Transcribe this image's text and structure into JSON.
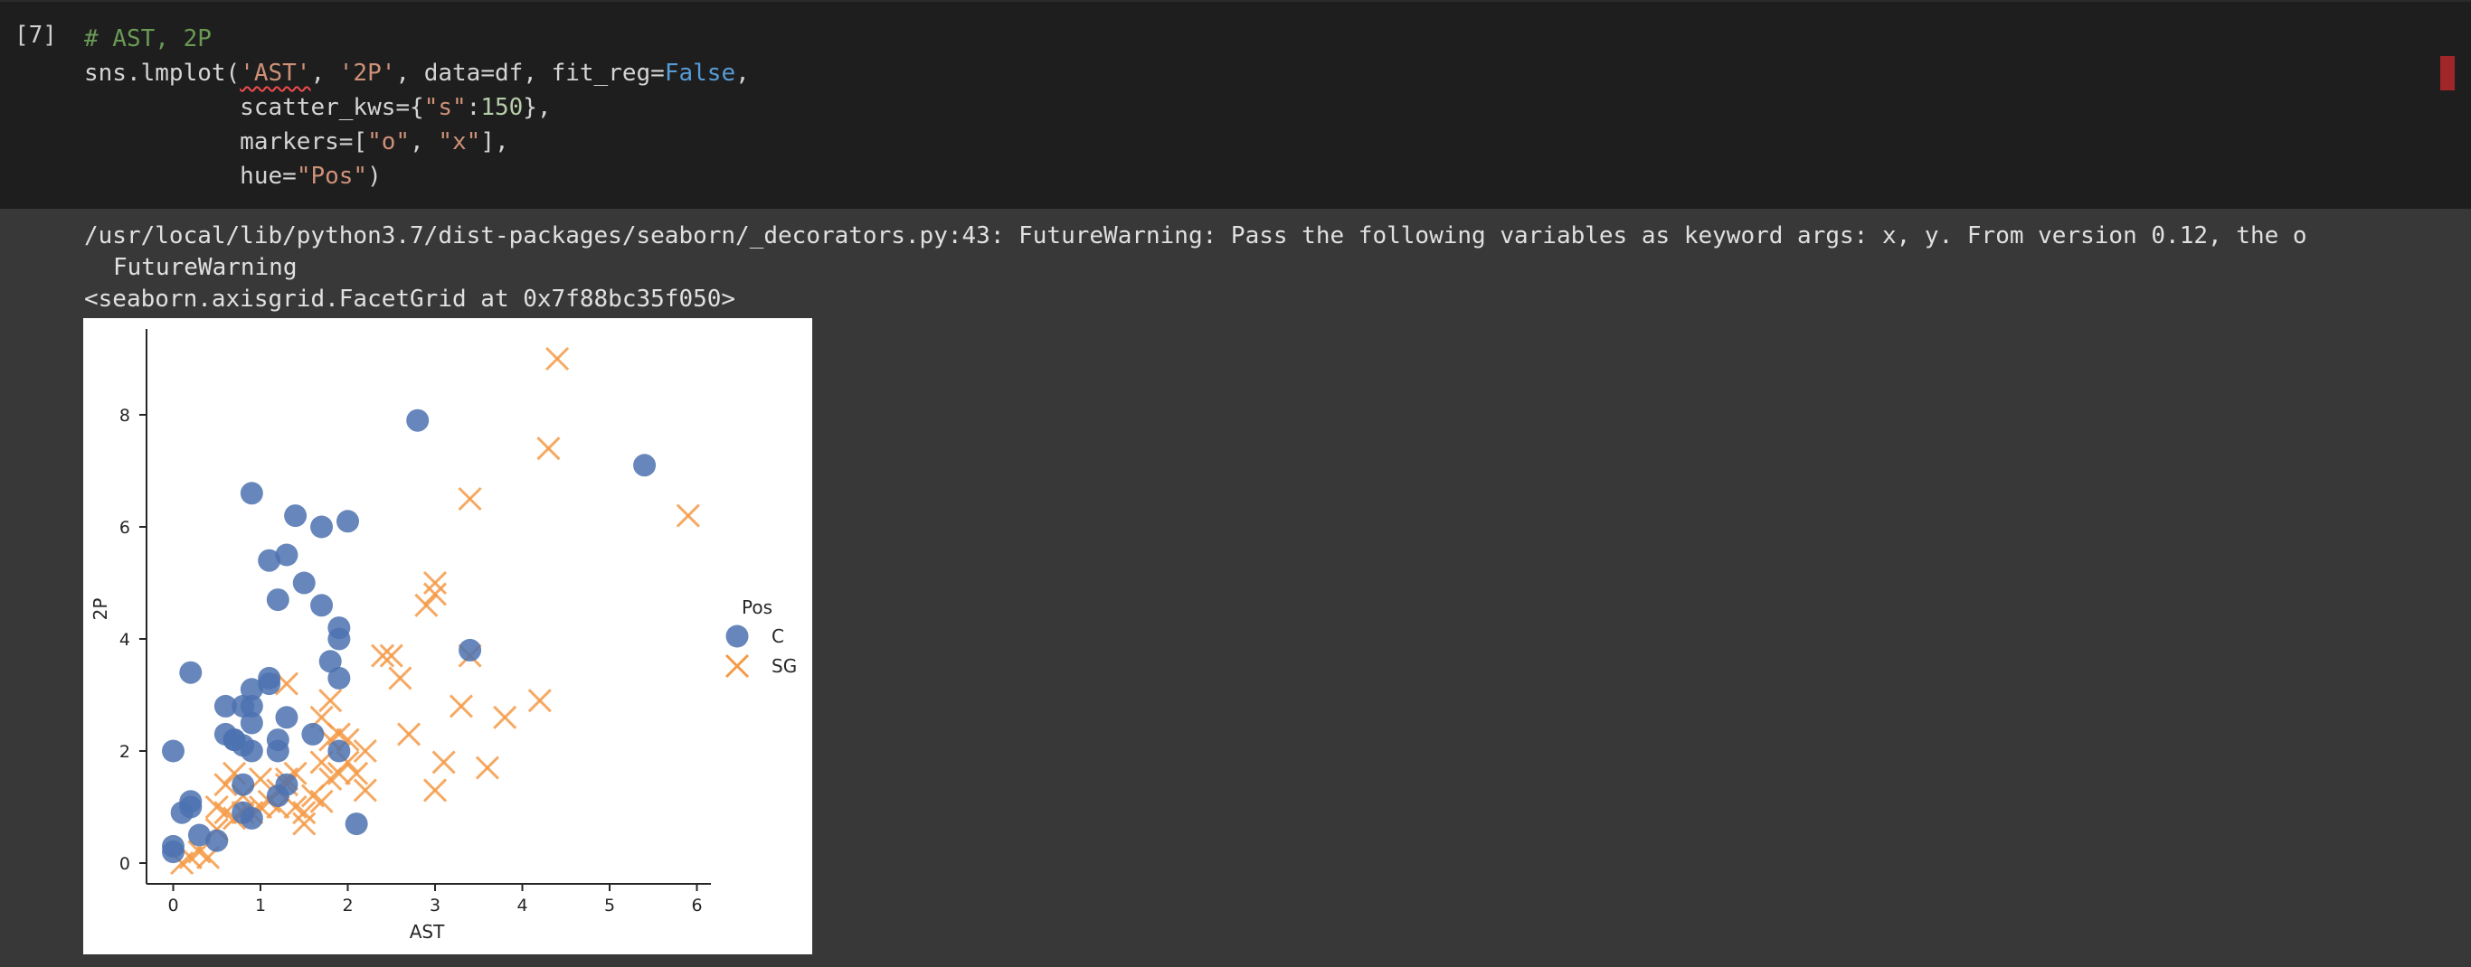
{
  "cell": {
    "execution_count": "[7]",
    "comment": "# AST, 2P",
    "code": {
      "l2_fn": "sns.lmplot(",
      "l2_arg1": "'AST'",
      "l2_sep1": ", ",
      "l2_arg2": "'2P'",
      "l2_mid": ", data=df, fit_reg=",
      "l2_false": "False",
      "l2_end": ",",
      "l3_pre": "           scatter_kws={",
      "l3_key": "\"s\"",
      "l3_colon": ":",
      "l3_num": "150",
      "l3_end": "},",
      "l4_pre": "           markers=[",
      "l4_o": "\"o\"",
      "l4_sep": ", ",
      "l4_x": "\"x\"",
      "l4_end": "],",
      "l5_pre": "           hue=",
      "l5_str": "\"Pos\"",
      "l5_end": ")"
    }
  },
  "output": {
    "warning_line1": "/usr/local/lib/python3.7/dist-packages/seaborn/_decorators.py:43: FutureWarning: Pass the following variables as keyword args: x, y. From version 0.12, the o",
    "warning_line2": "FutureWarning",
    "repr": "<seaborn.axisgrid.FacetGrid at 0x7f88bc35f050>"
  },
  "colors": {
    "C": "#4c72b0",
    "SG": "#f59a46"
  },
  "chart_data": {
    "type": "scatter",
    "xlabel": "AST",
    "ylabel": "2P",
    "xlim": [
      -0.3,
      6.2
    ],
    "ylim": [
      -0.4,
      9.4
    ],
    "xticks": [
      0,
      1,
      2,
      3,
      4,
      5,
      6
    ],
    "yticks": [
      0,
      2,
      4,
      6,
      8
    ],
    "legend": {
      "title": "Pos",
      "placement": "right"
    },
    "series": [
      {
        "name": "C",
        "marker": "o",
        "x": [
          0.0,
          0.0,
          0.1,
          0.2,
          0.2,
          0.3,
          0.5,
          0.6,
          0.6,
          0.7,
          0.7,
          0.8,
          0.8,
          0.8,
          0.8,
          0.9,
          0.9,
          0.9,
          0.9,
          0.9,
          1.1,
          1.1,
          1.1,
          1.2,
          1.2,
          1.2,
          1.2,
          1.3,
          1.3,
          1.3,
          1.4,
          1.5,
          1.6,
          1.7,
          1.7,
          1.8,
          1.9,
          1.9,
          1.9,
          1.9,
          2.0,
          2.1,
          2.8,
          3.4,
          5.4,
          0.2,
          0.0,
          0.9
        ],
        "y": [
          0.2,
          2.0,
          0.9,
          1.0,
          3.4,
          0.5,
          0.4,
          2.8,
          2.3,
          2.2,
          2.2,
          1.4,
          0.9,
          2.1,
          2.8,
          0.8,
          2.5,
          2.8,
          3.1,
          2.0,
          3.3,
          3.2,
          5.4,
          1.2,
          2.2,
          2.0,
          4.7,
          1.4,
          2.6,
          5.5,
          6.2,
          5.0,
          2.3,
          4.6,
          6.0,
          3.6,
          4.0,
          4.2,
          3.3,
          2.0,
          6.1,
          0.7,
          7.9,
          3.8,
          7.1,
          1.1,
          0.3,
          6.6
        ]
      },
      {
        "name": "SG",
        "marker": "x",
        "x": [
          0.1,
          0.2,
          0.3,
          0.4,
          0.5,
          0.5,
          0.6,
          0.6,
          0.7,
          0.7,
          0.8,
          0.8,
          0.9,
          1.0,
          1.0,
          1.1,
          1.2,
          1.2,
          1.3,
          1.3,
          1.4,
          1.4,
          1.5,
          1.5,
          1.6,
          1.7,
          1.7,
          1.7,
          1.8,
          1.8,
          1.9,
          1.9,
          2.0,
          2.0,
          2.1,
          2.2,
          2.2,
          2.4,
          2.5,
          2.6,
          2.7,
          2.9,
          3.0,
          3.0,
          3.0,
          3.1,
          3.3,
          3.4,
          3.4,
          3.6,
          3.8,
          4.2,
          4.3,
          4.4,
          5.9,
          1.3,
          1.8
        ],
        "y": [
          0.0,
          0.1,
          0.2,
          0.1,
          0.6,
          1.0,
          0.9,
          1.4,
          0.8,
          1.6,
          0.9,
          1.2,
          0.9,
          1.0,
          1.5,
          1.1,
          1.0,
          1.3,
          1.5,
          3.2,
          1.0,
          1.6,
          0.7,
          0.9,
          1.2,
          1.1,
          1.8,
          2.6,
          1.5,
          2.9,
          1.6,
          2.3,
          2.2,
          1.8,
          1.6,
          2.0,
          1.3,
          3.7,
          3.7,
          3.3,
          2.3,
          4.6,
          4.8,
          5.0,
          1.3,
          1.8,
          2.8,
          3.7,
          6.5,
          1.7,
          2.6,
          2.9,
          7.4,
          9.0,
          6.2,
          1.4,
          2.2
        ]
      }
    ]
  }
}
